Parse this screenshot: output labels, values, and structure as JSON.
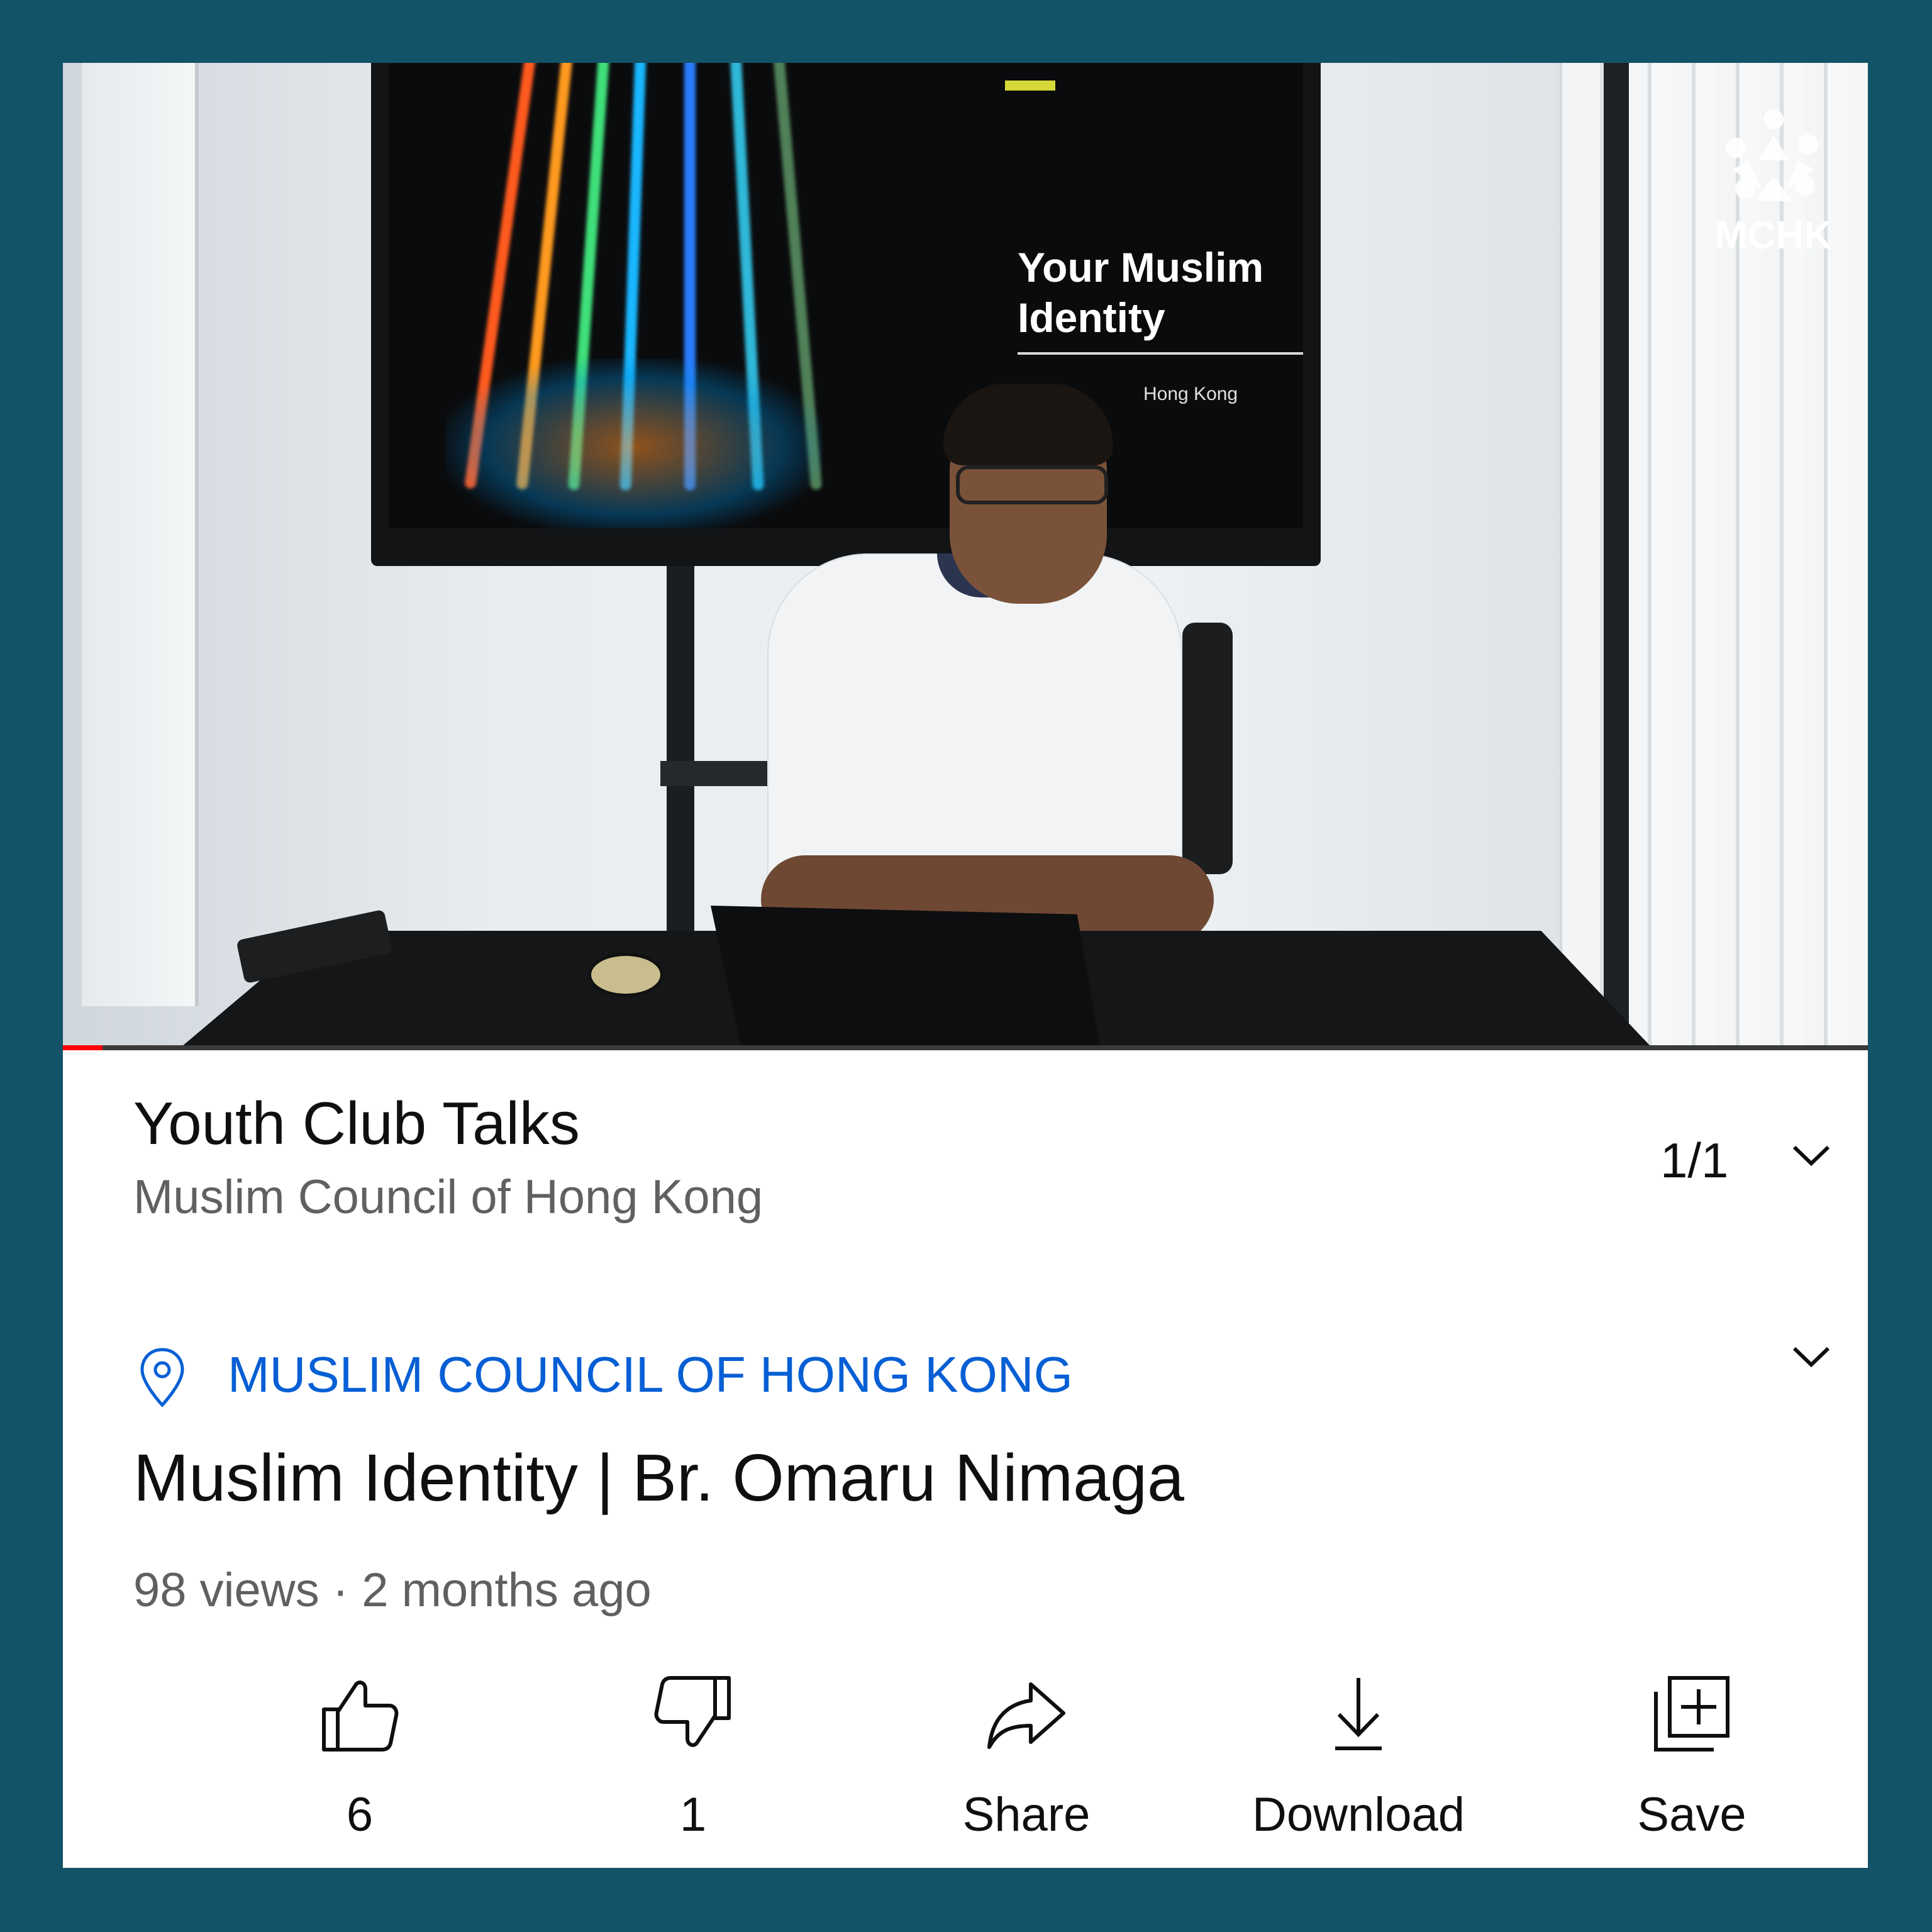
{
  "video": {
    "slide_title_line1": "Your Muslim",
    "slide_title_line2": "Identity",
    "slide_subtitle": "Hong Kong",
    "watermark": "MCHK",
    "progress_fraction": 0.022
  },
  "playlist": {
    "title": "Youth Club Talks",
    "channel": "Muslim Council of Hong Kong",
    "position": "1/1"
  },
  "location": {
    "label": "MUSLIM COUNCIL OF HONG KONG"
  },
  "video_info": {
    "title": "Muslim Identity | Br. Omaru Nimaga",
    "meta": "98 views · 2 months ago"
  },
  "actions": {
    "like": "6",
    "dislike": "1",
    "share": "Share",
    "download": "Download",
    "save": "Save"
  },
  "colors": {
    "background": "#135368",
    "link": "#065fd4",
    "progress": "#ff0000"
  },
  "icons": {
    "like": "thumbs-up-icon",
    "dislike": "thumbs-down-icon",
    "share": "share-arrow-icon",
    "download": "download-icon",
    "save": "add-to-playlist-icon",
    "location": "location-pin-icon",
    "expand": "chevron-down-icon"
  }
}
